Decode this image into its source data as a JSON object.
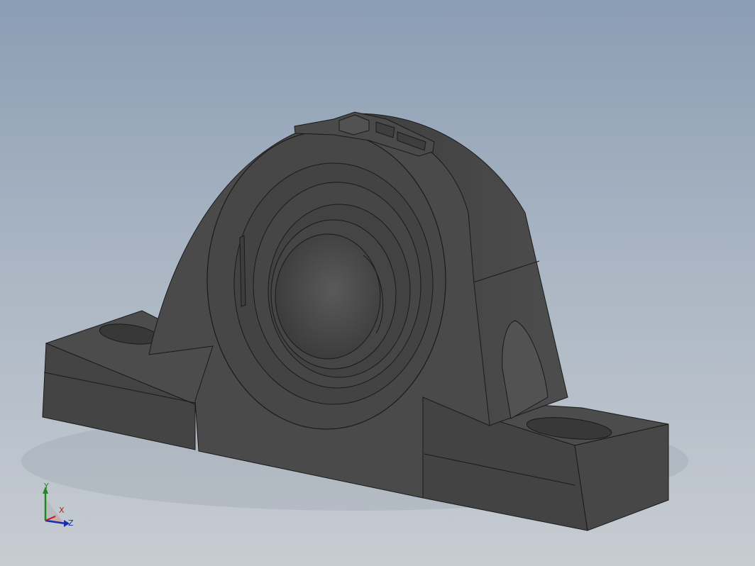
{
  "viewport": {
    "background_top": "#8b9db4",
    "background_bottom": "#c7ccd2"
  },
  "model": {
    "body_color": "#494949",
    "edge_color": "#1a1a1a"
  },
  "triad": {
    "y_label": "Y",
    "x_label": "X",
    "z_label": "Z",
    "y_color": "#1f8a1f",
    "x_color": "#b02020",
    "z_color": "#1a2fa8"
  }
}
